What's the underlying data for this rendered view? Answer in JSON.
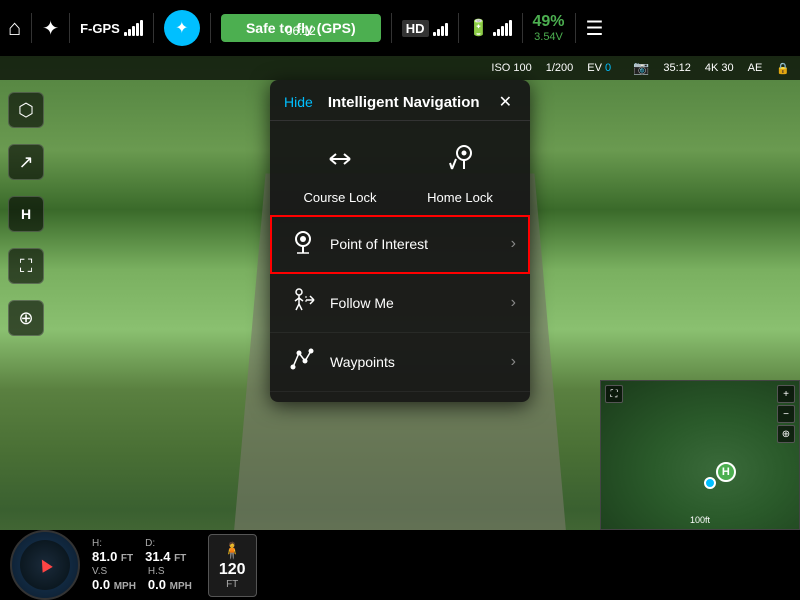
{
  "topBar": {
    "homeIcon": "⌂",
    "droneIcon": "✦",
    "gpsLabel": "F-GPS",
    "signalIcon": "📶",
    "statusText": "Safe to fly (GPS)",
    "timer": "06:12",
    "hdLabel": "HD",
    "batteryPercent": "49%",
    "batteryVolt": "3.54V",
    "menuIcon": "☰"
  },
  "secondBar": {
    "iso": "ISO 100",
    "shutter": "1/200",
    "ev": "EV 0",
    "storage": "35:12",
    "resolution": "4K 30",
    "ae": "AE"
  },
  "leftSidebar": {
    "icons": [
      "⬡",
      "↗",
      "H",
      "⛶",
      "⊕"
    ]
  },
  "modal": {
    "hideLabel": "Hide",
    "title": "Intelligent Navigation",
    "closeIcon": "✕",
    "gridItems": [
      {
        "icon": "⇄",
        "label": "Course Lock"
      },
      {
        "icon": "📍",
        "label": "Home Lock"
      }
    ],
    "listItems": [
      {
        "icon": "◎",
        "label": "Point of Interest",
        "chevron": "›",
        "highlighted": true
      },
      {
        "icon": "👣",
        "label": "Follow Me",
        "chevron": "›",
        "highlighted": false
      },
      {
        "icon": "⟲",
        "label": "Waypoints",
        "chevron": "›",
        "highlighted": false
      }
    ]
  },
  "bottomBar": {
    "compass": "compass",
    "telemetry": [
      {
        "label": "H:",
        "value": "81.0",
        "unit": "FT"
      },
      {
        "label": "D:",
        "value": "31.4",
        "unit": "FT"
      }
    ],
    "speed": [
      {
        "label": "V.S",
        "value": "0.0",
        "unit": "MPH"
      },
      {
        "label": "H.S",
        "value": "0.0",
        "unit": "MPH"
      }
    ],
    "altitudeLabel": "120",
    "altitudeUnit": "FT",
    "personIcon": "🧍"
  },
  "miniMap": {
    "hMarker": "H",
    "scaleLabel": "100ft"
  }
}
